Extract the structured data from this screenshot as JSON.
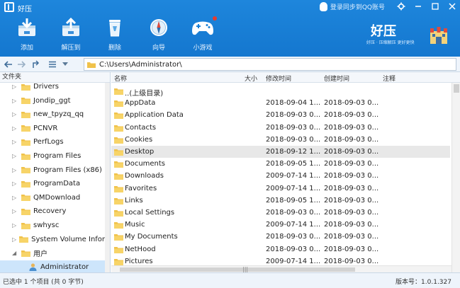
{
  "app": {
    "title": "好压",
    "login_text": "登录同步到QQ账号"
  },
  "toolbar": {
    "buttons": [
      {
        "label": "添加",
        "icon": "add-archive-icon"
      },
      {
        "label": "解压到",
        "icon": "extract-icon"
      },
      {
        "label": "删除",
        "icon": "recycle-bin-icon"
      },
      {
        "label": "向导",
        "icon": "compass-icon"
      },
      {
        "label": "小游戏",
        "icon": "gamepad-icon"
      }
    ]
  },
  "brand": {
    "name": "好压",
    "slogan": "好压 · 压缩解压  更好更快"
  },
  "address": {
    "path": "C:\\Users\\Administrator\\"
  },
  "tree": {
    "header": "文件夹",
    "items": [
      {
        "label": "Drivers"
      },
      {
        "label": "Jondip_ggt"
      },
      {
        "label": "new_tpyzq_qq"
      },
      {
        "label": "PCNVR"
      },
      {
        "label": "PerfLogs"
      },
      {
        "label": "Program Files"
      },
      {
        "label": "Program Files (x86)"
      },
      {
        "label": "ProgramData"
      },
      {
        "label": "QMDownload"
      },
      {
        "label": "Recovery"
      },
      {
        "label": "swhysc"
      },
      {
        "label": "System Volume Infor..."
      },
      {
        "label": "用户"
      },
      {
        "label": "Administrator"
      }
    ]
  },
  "list": {
    "columns": {
      "name": "名称",
      "size": "大小",
      "modified": "修改时间",
      "created": "创建时间",
      "comment": "注释"
    },
    "rows": [
      {
        "name": "..(上级目录)",
        "modified": "",
        "created": ""
      },
      {
        "name": "AppData",
        "modified": "2018-09-04 1...",
        "created": "2018-09-03 0..."
      },
      {
        "name": "Application Data",
        "modified": "2018-09-03 0...",
        "created": "2018-09-03 0..."
      },
      {
        "name": "Contacts",
        "modified": "2018-09-03 0...",
        "created": "2018-09-03 0..."
      },
      {
        "name": "Cookies",
        "modified": "2018-09-03 0...",
        "created": "2018-09-03 0..."
      },
      {
        "name": "Desktop",
        "modified": "2018-09-12 1...",
        "created": "2018-09-03 0..."
      },
      {
        "name": "Documents",
        "modified": "2018-09-05 1...",
        "created": "2018-09-03 0..."
      },
      {
        "name": "Downloads",
        "modified": "2009-07-14 1...",
        "created": "2018-09-03 0..."
      },
      {
        "name": "Favorites",
        "modified": "2009-07-14 1...",
        "created": "2018-09-03 0..."
      },
      {
        "name": "Links",
        "modified": "2018-09-05 1...",
        "created": "2018-09-03 0..."
      },
      {
        "name": "Local Settings",
        "modified": "2018-09-03 0...",
        "created": "2018-09-03 0..."
      },
      {
        "name": "Music",
        "modified": "2009-07-14 1...",
        "created": "2018-09-03 0..."
      },
      {
        "name": "My Documents",
        "modified": "2018-09-03 0...",
        "created": "2018-09-03 0..."
      },
      {
        "name": "NetHood",
        "modified": "2018-09-03 0...",
        "created": "2018-09-03 0..."
      },
      {
        "name": "Pictures",
        "modified": "2009-07-14 1...",
        "created": "2018-09-03 0..."
      }
    ]
  },
  "status": {
    "left": "已选中 1 个项目 (共 0 字节)",
    "version": "版本号：1.0.1.327"
  },
  "colors": {
    "toolbar_blue": "#1a80d6",
    "folder_yellow": "#f0c24a",
    "selection_blue": "#cde5fb"
  }
}
